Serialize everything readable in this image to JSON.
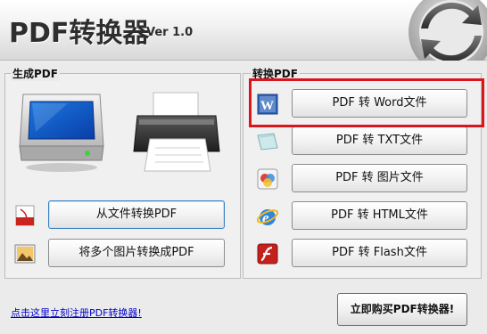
{
  "header": {
    "title": "PDF转换器",
    "version": "Ver 1.0"
  },
  "left_panel": {
    "title": "生成PDF",
    "buttons": [
      {
        "label": "从文件转换PDF",
        "icon": "pdf-file-icon"
      },
      {
        "label": "将多个图片转换成PDF",
        "icon": "picture-icon"
      }
    ],
    "illustrations": [
      "monitor-icon",
      "printer-icon"
    ]
  },
  "right_panel": {
    "title": "转换PDF",
    "buttons": [
      {
        "label": "PDF 转 Word文件",
        "icon": "word-icon"
      },
      {
        "label": "PDF 转 TXT文件",
        "icon": "txt-icon"
      },
      {
        "label": "PDF 转 图片文件",
        "icon": "image-icon"
      },
      {
        "label": "PDF 转 HTML文件",
        "icon": "ie-icon"
      },
      {
        "label": "PDF 转 Flash文件",
        "icon": "flash-icon"
      }
    ]
  },
  "footer": {
    "register_link": "点击这里立刻注册PDF转换器!",
    "buy_button": "立即购买PDF转换器!"
  },
  "colors": {
    "highlight": "#d9161b",
    "link": "#0000cc"
  }
}
